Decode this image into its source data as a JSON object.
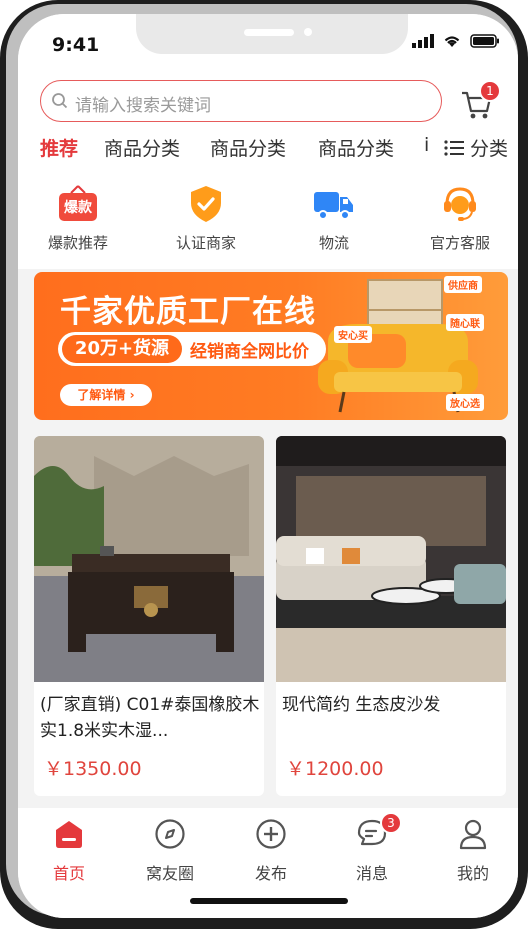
{
  "status": {
    "time": "9:41"
  },
  "search": {
    "placeholder": "请输入搜索关键词"
  },
  "cart": {
    "badge": "1"
  },
  "tabs": [
    {
      "label": "推荐",
      "active": true
    },
    {
      "label": "商品分类"
    },
    {
      "label": "商品分类"
    },
    {
      "label": "商品分类"
    },
    {
      "label": "i"
    },
    {
      "label": "分类"
    }
  ],
  "shortcuts": [
    {
      "label": "爆款推荐",
      "icon": "hot-sale-icon",
      "icon_text": "爆款"
    },
    {
      "label": "认证商家",
      "icon": "verified-shield-icon"
    },
    {
      "label": "物流",
      "icon": "truck-icon"
    },
    {
      "label": "官方客服",
      "icon": "customer-service-icon"
    }
  ],
  "banner": {
    "headline": "千家优质工厂在线",
    "pill_left": "20万+货源",
    "pill_right": "经销商全网比价",
    "more": "了解详情",
    "tags": [
      "供应商",
      "安心买",
      "随心联",
      "放心选"
    ]
  },
  "products": [
    {
      "title": "(厂家直销) C01#泰国橡胶木实1.8米实木湿...",
      "price": "￥1350.00"
    },
    {
      "title": "现代简约  生态皮沙发",
      "price": "￥1200.00"
    }
  ],
  "tabbar": [
    {
      "label": "首页",
      "icon": "home-icon",
      "active": true
    },
    {
      "label": "窝友圈",
      "icon": "compass-icon"
    },
    {
      "label": "发布",
      "icon": "plus-circle-icon"
    },
    {
      "label": "消息",
      "icon": "message-icon",
      "badge": "3"
    },
    {
      "label": "我的",
      "icon": "user-icon"
    }
  ],
  "colors": {
    "accent": "#e4393c",
    "banner": "#ff6e1d",
    "truck": "#2f86f6",
    "shield": "#ff9c1a"
  }
}
